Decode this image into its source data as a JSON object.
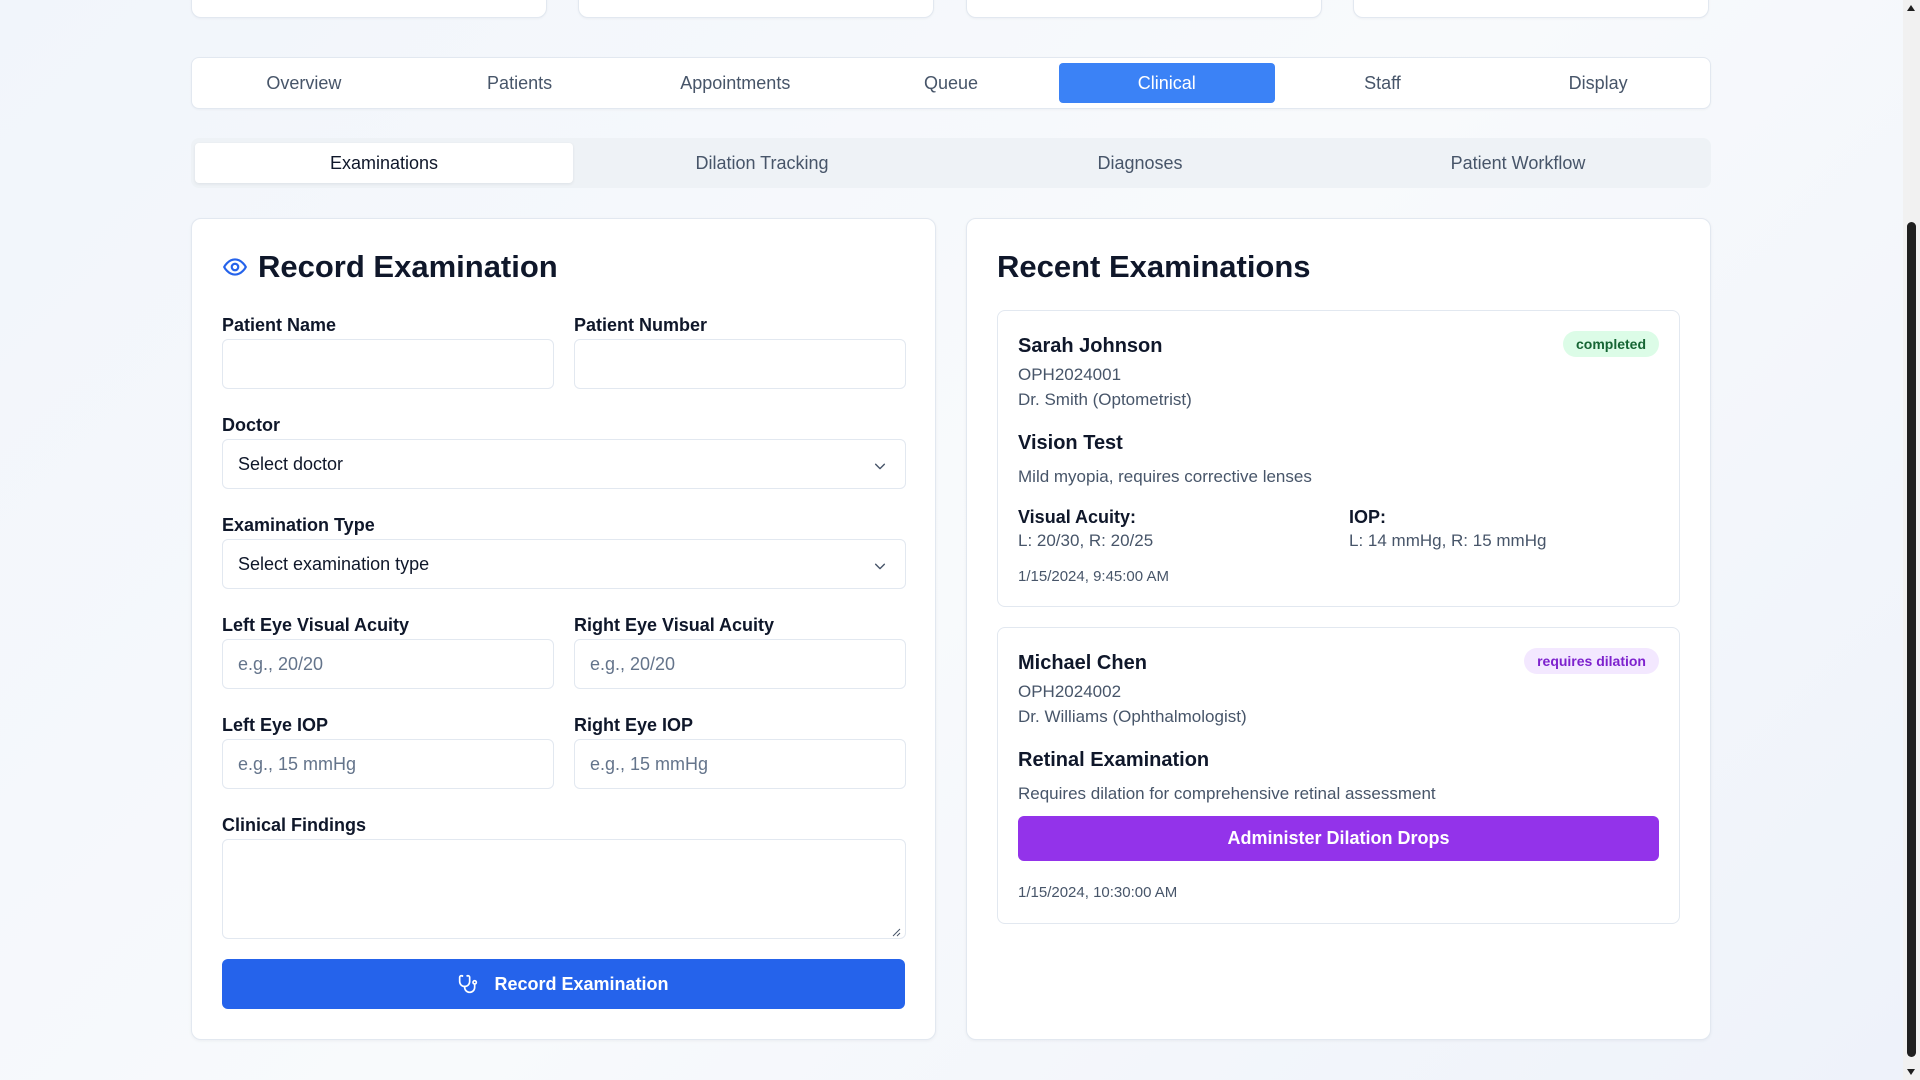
{
  "colors": {
    "primary": "#2563eb",
    "active_tab": "#3b82f6",
    "dilation_button": "#9333ea",
    "badge_completed_bg": "#dcfce7",
    "badge_completed_text": "#166534",
    "badge_dilation_bg": "#f3e8ff",
    "badge_dilation_text": "#7e22ce"
  },
  "main_tabs": [
    "Overview",
    "Patients",
    "Appointments",
    "Queue",
    "Clinical",
    "Staff",
    "Display"
  ],
  "main_tabs_active": "Clinical",
  "sub_tabs": [
    "Examinations",
    "Dilation Tracking",
    "Diagnoses",
    "Patient Workflow"
  ],
  "sub_tabs_active": "Examinations",
  "form": {
    "title": "Record Examination",
    "title_icon": "eye-icon",
    "patient_name_label": "Patient Name",
    "patient_name_value": "",
    "patient_number_label": "Patient Number",
    "patient_number_value": "",
    "doctor_label": "Doctor",
    "doctor_value": "Select doctor",
    "exam_type_label": "Examination Type",
    "exam_type_value": "Select examination type",
    "left_va_label": "Left Eye Visual Acuity",
    "left_va_placeholder": "e.g., 20/20",
    "right_va_label": "Right Eye Visual Acuity",
    "right_va_placeholder": "e.g., 20/20",
    "left_iop_label": "Left Eye IOP",
    "left_iop_placeholder": "e.g., 15 mmHg",
    "right_iop_label": "Right Eye IOP",
    "right_iop_placeholder": "e.g., 15 mmHg",
    "findings_label": "Clinical Findings",
    "submit_label": "Record Examination",
    "submit_icon": "stethoscope-icon"
  },
  "recent": {
    "title": "Recent Examinations",
    "exams": [
      {
        "patient": "Sarah Johnson",
        "number": "OPH2024001",
        "doctor": "Dr. Smith (Optometrist)",
        "status": "completed",
        "type": "Vision Test",
        "notes": "Mild myopia, requires corrective lenses",
        "va_label": "Visual Acuity:",
        "va_value": "L: 20/30, R: 20/25",
        "iop_label": "IOP:",
        "iop_value": "L: 14 mmHg, R: 15 mmHg",
        "timestamp": "1/15/2024, 9:45:00 AM"
      },
      {
        "patient": "Michael Chen",
        "number": "OPH2024002",
        "doctor": "Dr. Williams (Ophthalmologist)",
        "status": "requires dilation",
        "type": "Retinal Examination",
        "notes": "Requires dilation for comprehensive retinal assessment",
        "action_label": "Administer Dilation Drops",
        "timestamp": "1/15/2024, 10:30:00 AM"
      }
    ]
  }
}
